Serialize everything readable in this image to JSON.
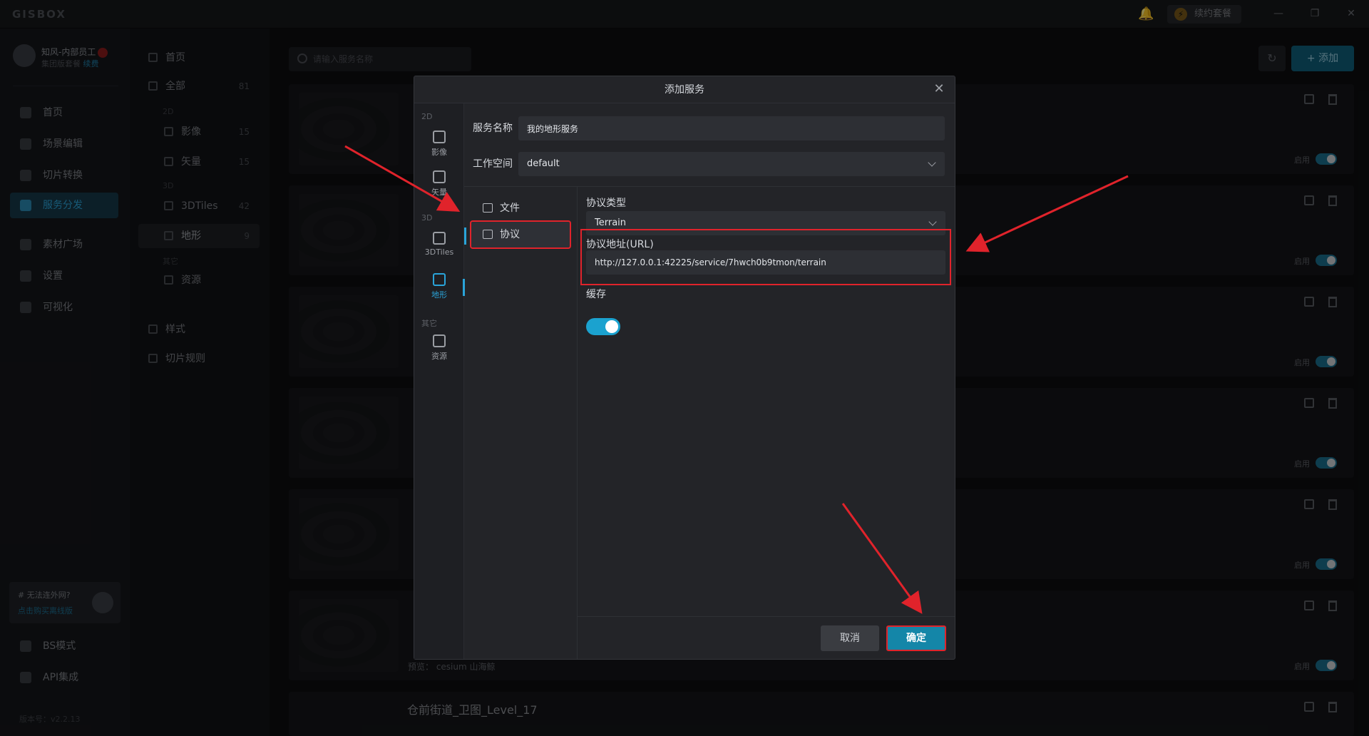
{
  "app": {
    "logo": "GISBOX",
    "plan_button": "续约套餐"
  },
  "user": {
    "name": "知风-内部员工",
    "edition": "集团版套餐",
    "renew": "续费"
  },
  "nav": [
    {
      "label": "首页"
    },
    {
      "label": "场景编辑"
    },
    {
      "label": "切片转换"
    },
    {
      "label": "服务分发"
    },
    {
      "label": "素材广场"
    },
    {
      "label": "设置"
    },
    {
      "label": "可视化"
    }
  ],
  "nav_bottom": [
    {
      "label": "BS模式"
    },
    {
      "label": "API集成"
    }
  ],
  "promo": {
    "title": "# 无法连外网?",
    "link": "点击购买离线版"
  },
  "version": "版本号：v2.2.13",
  "categories": {
    "home": "首页",
    "all": {
      "label": "全部",
      "count": "81"
    },
    "g2d": "2D",
    "imagery": {
      "label": "影像",
      "count": "15"
    },
    "vector": {
      "label": "矢量",
      "count": "15"
    },
    "g3d": "3D",
    "tiles": {
      "label": "3DTiles",
      "count": "42"
    },
    "terrain": {
      "label": "地形",
      "count": "9"
    },
    "gother": "其它",
    "resource": {
      "label": "资源"
    },
    "style": "样式",
    "tile_rule": "切片规则"
  },
  "main": {
    "search_placeholder": "请输入服务名称",
    "add_label": "添加",
    "enable_label": "启用",
    "last_card_title": "仓前街道_卫图_Level_17",
    "preview": "预览： cesium  山海鲸"
  },
  "modal": {
    "title": "添加服务",
    "name_label": "服务名称",
    "name_value": "我的地形服务",
    "workspace_label": "工作空间",
    "workspace_value": "default",
    "types": {
      "g2d": "2D",
      "imagery": "影像",
      "vector": "矢量",
      "g3d": "3D",
      "tiles": "3DTiles",
      "terrain": "地形",
      "gother": "其它",
      "resource": "资源"
    },
    "source_file": "文件",
    "source_protocol": "协议",
    "protocol_type_label": "协议类型",
    "protocol_type_value": "Terrain",
    "url_label": "协议地址(URL)",
    "url_value": "http://127.0.0.1:42225/service/7hwch0b9tmon/terrain",
    "cache_label": "缓存",
    "cache_enabled": true,
    "cancel": "取消",
    "confirm": "确定"
  },
  "colors": {
    "accent": "#1ba2cf",
    "highlight": "#e0232b",
    "background": "#101113"
  }
}
